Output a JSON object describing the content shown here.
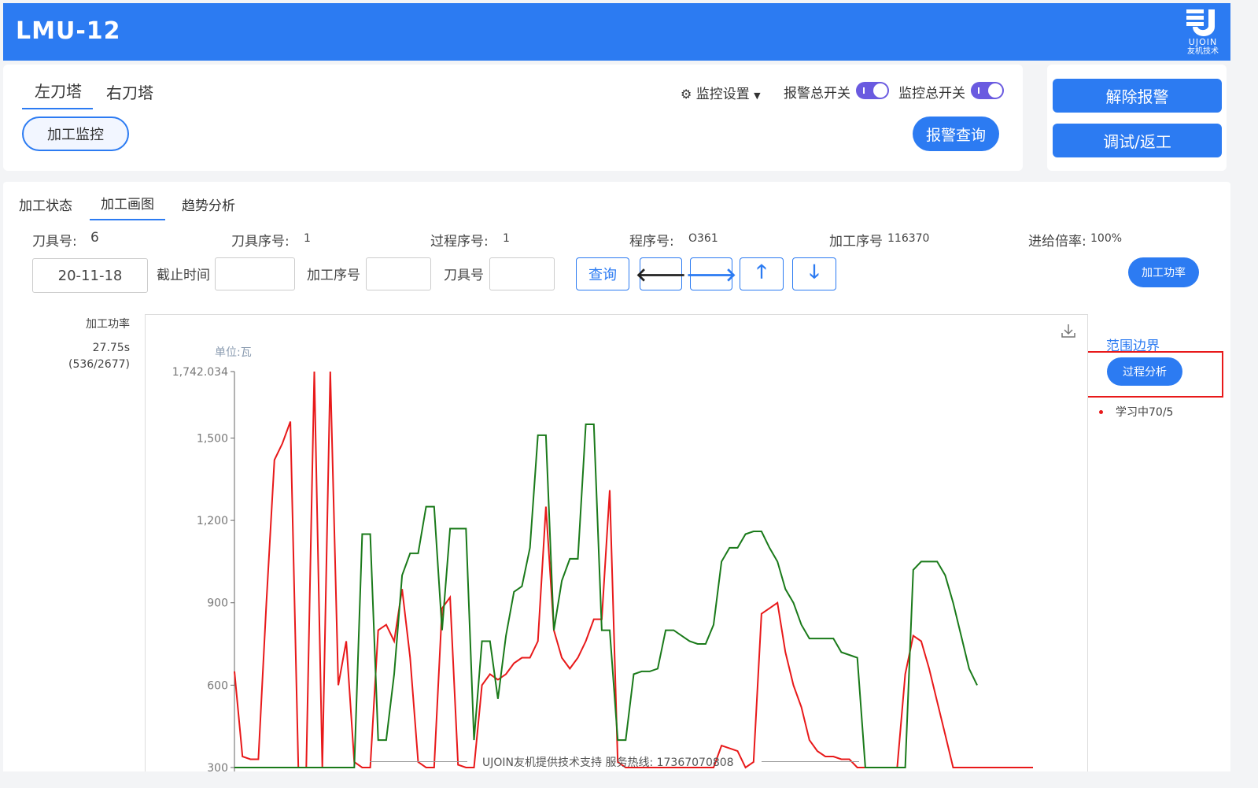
{
  "app": {
    "title": "LMU-12"
  },
  "logo": {
    "en": "UJOIN",
    "cn": "友机技术"
  },
  "turret_tabs": [
    {
      "label": "左刀塔"
    },
    {
      "label": "右刀塔"
    }
  ],
  "monitor_button": "加工监控",
  "monitor_settings": "监控设置",
  "alarm_switch_label": "报警总开关",
  "monitor_switch_label": "监控总开关",
  "alarm_query_button": "报警查询",
  "clear_alarm_button": "解除报警",
  "debug_rework_button": "调试/返工",
  "sub_tabs": [
    {
      "label": "加工状态"
    },
    {
      "label": "加工画图"
    },
    {
      "label": "趋势分析"
    }
  ],
  "info": {
    "tool_no_label": "刀具号:",
    "tool_no": "6",
    "tool_seq_label": "刀具序号:",
    "tool_seq": "1",
    "process_seq_label": "过程序号:",
    "process_seq": "1",
    "program_label": "程序号:",
    "program": "O361",
    "machining_seq_label": "加工序号",
    "machining_seq": "116370",
    "feed_rate_label": "进给倍率:",
    "feed_rate": "100%"
  },
  "filters": {
    "start_date": "20-11-18",
    "end_time_label": "截止时间",
    "machining_seq_label": "加工序号",
    "tool_label": "刀具号",
    "query_button": "查询",
    "power_button": "加工功率"
  },
  "side_info": {
    "title": "加工功率",
    "time": "27.75s",
    "range": "(536/2677)"
  },
  "chart_panel": {
    "range_boundary": "范围边界",
    "process_analysis_button": "过程分析",
    "legend_learning": "学习中70/5"
  },
  "footer": {
    "text": "UJOIN友机提供技术支持 服务热线: 17367070808"
  },
  "chart_data": {
    "type": "line",
    "unit": "单位:瓦",
    "ylim": [
      300,
      1742.034
    ],
    "yticks": [
      "1,742.034",
      "1,500",
      "1,200",
      "900",
      "600",
      "300"
    ],
    "x": [
      0,
      10,
      20,
      30,
      40,
      50,
      60,
      70,
      80,
      90,
      100,
      110,
      120,
      130,
      140,
      150,
      160,
      170,
      180,
      190,
      200,
      210,
      220,
      230,
      240,
      250,
      260,
      270,
      280,
      290,
      300,
      310,
      320,
      330,
      340,
      350,
      360,
      370,
      380,
      390,
      400,
      410,
      420,
      430,
      440,
      450,
      460,
      470,
      480,
      490,
      500,
      510,
      520,
      530,
      540,
      550,
      560,
      570,
      580,
      590,
      600,
      610,
      620,
      630,
      640,
      650,
      660,
      670,
      680,
      690,
      700,
      710,
      720,
      730,
      740,
      750,
      760,
      770,
      780,
      790,
      800,
      810,
      820,
      830,
      840,
      850,
      860,
      870,
      880,
      890,
      900,
      910,
      920,
      930,
      940,
      950,
      960,
      970,
      980,
      990,
      1000
    ],
    "series": [
      {
        "color": "#e8191a",
        "values": [
          650,
          340,
          330,
          330,
          900,
          1420,
          1480,
          1560,
          300,
          300,
          1742,
          300,
          1742,
          600,
          760,
          320,
          300,
          300,
          800,
          820,
          760,
          950,
          700,
          320,
          300,
          300,
          880,
          920,
          310,
          300,
          300,
          600,
          640,
          620,
          640,
          680,
          700,
          700,
          760,
          1250,
          800,
          700,
          660,
          700,
          760,
          840,
          840,
          1310,
          320,
          300,
          300,
          300,
          300,
          300,
          300,
          300,
          300,
          300,
          300,
          300,
          300,
          380,
          370,
          360,
          300,
          320,
          860,
          880,
          900,
          720,
          600,
          520,
          400,
          360,
          340,
          340,
          330,
          330,
          300,
          300,
          300,
          300,
          300,
          300,
          640,
          780,
          760,
          660,
          540,
          420,
          300,
          300,
          300,
          300,
          300,
          300,
          300,
          300,
          300,
          300,
          300
        ]
      },
      {
        "color": "#1a7a1a",
        "values": [
          300,
          300,
          300,
          300,
          300,
          300,
          300,
          300,
          300,
          300,
          300,
          300,
          300,
          300,
          300,
          300,
          1150,
          1150,
          400,
          400,
          640,
          1000,
          1080,
          1080,
          1250,
          1250,
          800,
          1170,
          1170,
          1170,
          400,
          760,
          760,
          550,
          780,
          940,
          960,
          1100,
          1510,
          1510,
          800,
          980,
          1060,
          1060,
          1550,
          1550,
          800,
          800,
          400,
          400,
          640,
          650,
          650,
          660,
          800,
          800,
          780,
          760,
          750,
          750,
          820,
          1050,
          1100,
          1100,
          1150,
          1160,
          1160,
          1100,
          1050,
          950,
          900,
          820,
          770,
          770,
          770,
          770,
          720,
          710,
          700,
          300,
          300,
          300,
          300,
          300,
          300,
          1020,
          1050,
          1050,
          1050,
          1000,
          900,
          780,
          660,
          600
        ]
      }
    ]
  }
}
